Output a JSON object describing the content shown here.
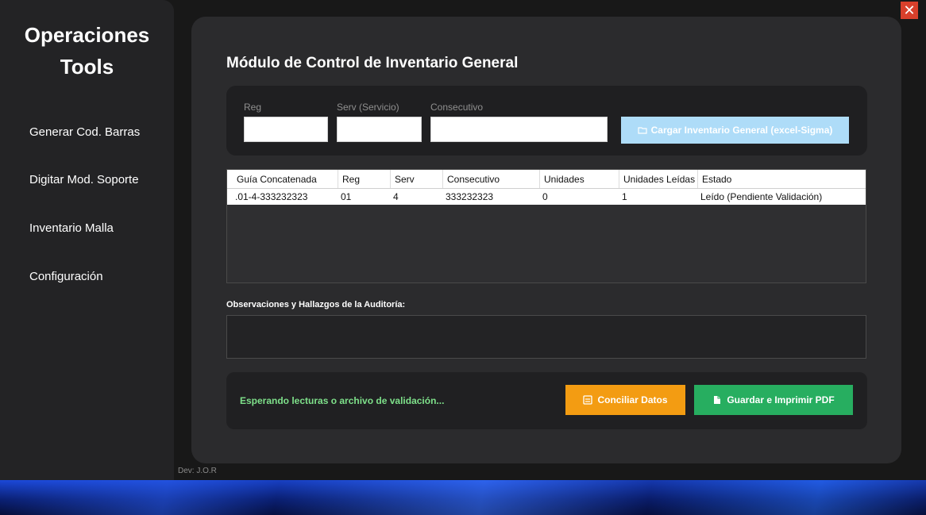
{
  "window": {
    "close_glyph": "✕"
  },
  "sidebar": {
    "brand_line1": "Operaciones",
    "brand_line2": "Tools",
    "items": [
      {
        "label": "Generar Cod. Barras"
      },
      {
        "label": "Digitar Mod. Soporte"
      },
      {
        "label": "Inventario Malla"
      },
      {
        "label": "Configuración"
      }
    ],
    "dev_credit": "Dev: J.O.R"
  },
  "main": {
    "title": "Módulo de Control de Inventario General",
    "form": {
      "reg_label": "Reg",
      "reg_value": "",
      "serv_label": "Serv (Servicio)",
      "serv_value": "",
      "consecutivo_label": "Consecutivo",
      "consecutivo_value": "",
      "load_button": "Cargar Inventario General (excel-Sigma)",
      "load_icon": "folder-icon"
    },
    "table": {
      "columns": [
        "Guía Concatenada",
        "Reg",
        "Serv",
        "Consecutivo",
        "Unidades",
        "Unidades Leídas",
        "Estado"
      ],
      "rows": [
        [
          ".01-4-333232323",
          "01",
          "4",
          "333232323",
          "0",
          "1",
          "Leído (Pendiente Validación)"
        ]
      ]
    },
    "observations_label": "Observaciones y Hallazgos de la Auditoría:",
    "observations_value": "",
    "status_text": "Esperando lecturas o archivo de validación...",
    "reconcile_button": "Conciliar Datos",
    "print_button": "Guardar e Imprimir PDF"
  },
  "colors": {
    "accent_orange": "#f39c12",
    "accent_green": "#27ae60",
    "load_button_disabled": "#aedcf8",
    "status_text": "#7ee08a",
    "close_button": "#d9402b"
  }
}
